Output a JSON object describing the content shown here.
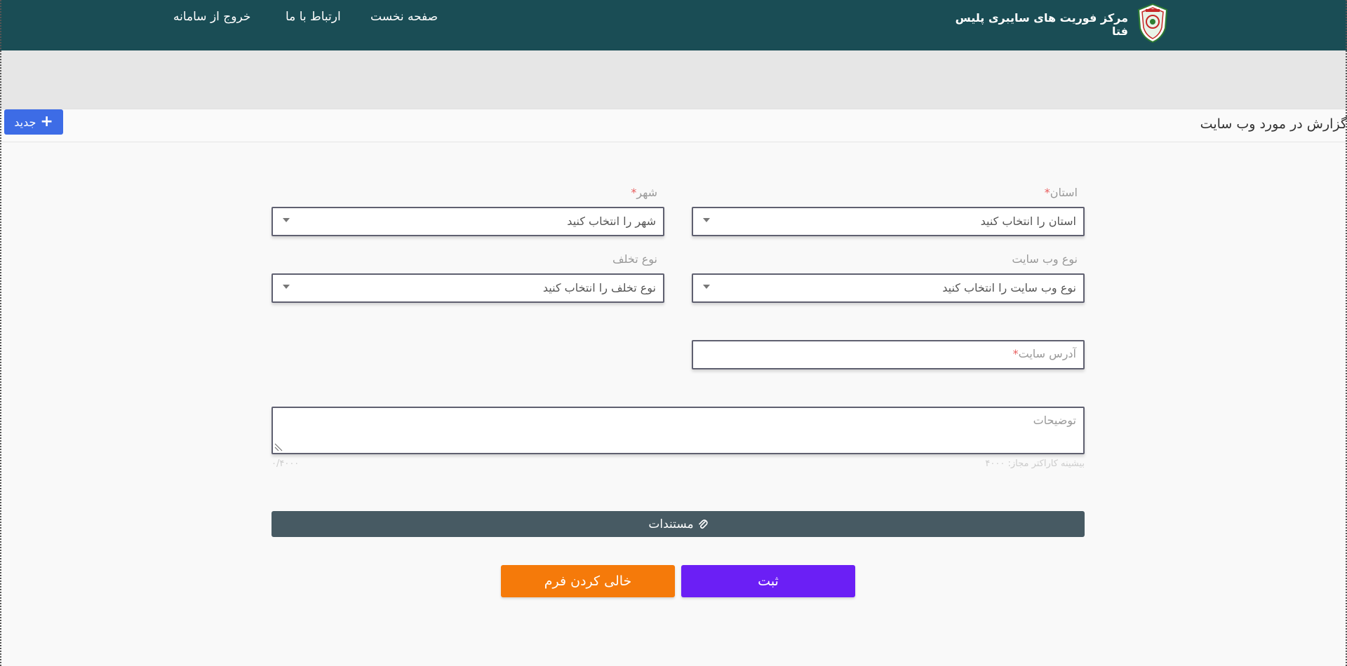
{
  "header": {
    "site_title": "مرکز فوریت های سایبری پلیس فتا",
    "nav": {
      "home": "صفحه نخست",
      "contact": "ارتباط با ما",
      "logout": "خروج از سامانه"
    }
  },
  "page": {
    "title": "گزارش در مورد وب سایت",
    "new_button": "جدید"
  },
  "form": {
    "province": {
      "label": "استان",
      "placeholder": "استان را انتخاب کنید",
      "required": "*"
    },
    "city": {
      "label": "شهر",
      "placeholder": "شهر را انتخاب کنید",
      "required": "*"
    },
    "website_type": {
      "label": "نوع وب سایت",
      "placeholder": "نوع وب سایت را انتخاب کنید"
    },
    "violation_type": {
      "label": "نوع تخلف",
      "placeholder": "نوع تخلف را انتخاب کنید"
    },
    "site_address": {
      "placeholder": "آدرس سایت",
      "required": "*"
    },
    "description": {
      "placeholder": "توضیحات",
      "max_hint": "بیشینه کاراکتر مجاز: ۴۰۰۰",
      "counter": "۰/۴۰۰۰"
    },
    "documents_label": "مستندات",
    "submit_label": "ثبت",
    "clear_label": "خالی کردن فرم"
  },
  "colors": {
    "header_bg": "#1a4d55",
    "submit": "#6b1ff5",
    "clear": "#f57a0a",
    "docs": "#475a63",
    "new_button": "#3d6ce6"
  }
}
